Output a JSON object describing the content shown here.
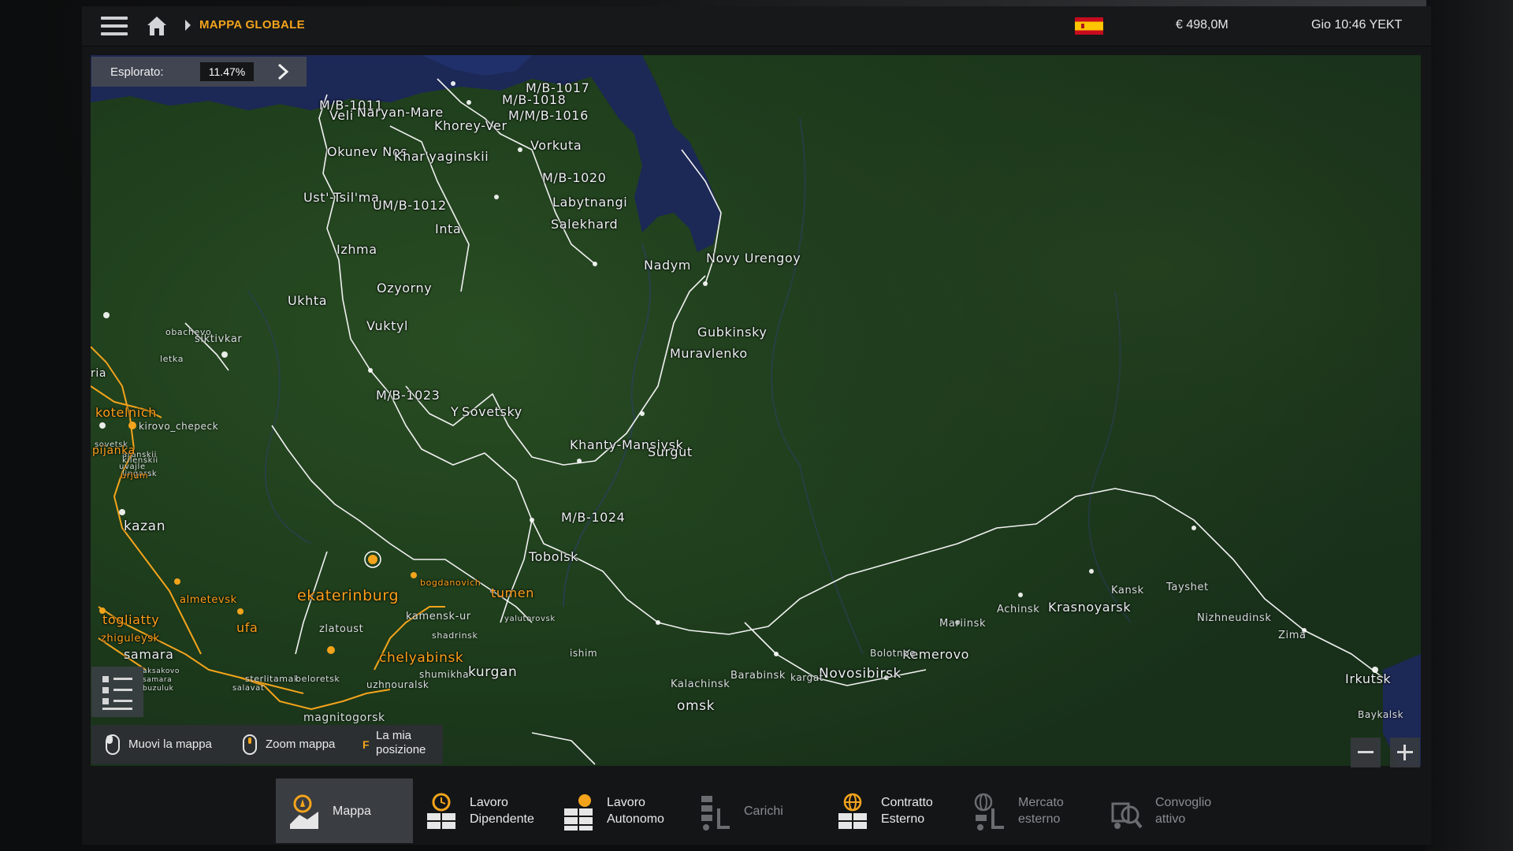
{
  "header": {
    "breadcrumb": "MAPPA GLOBALE",
    "money": "€ 498,0M",
    "clock": "Gio 10:46 YEKT"
  },
  "explored": {
    "label": "Esplorato:",
    "value": "11.47%"
  },
  "hints": {
    "move": "Muovi la mappa",
    "zoom": "Zoom mappa",
    "position_key": "F",
    "position_line1": "La mia",
    "position_line2": "posizione"
  },
  "colors": {
    "accent": "#f3a41c",
    "map_green": "#1d3a1b",
    "water": "#1c2a5c",
    "route_visited": "#f3a41c",
    "route_unvisited": "#ffffff"
  },
  "map": {
    "cities_white": [
      "M/B-1017",
      "M/B-1018",
      "M/M/B-1016",
      "M/B-1011",
      "Veli",
      "Naryan-Mare",
      "Khorey-Ver",
      "Vorkuta",
      "Okunev Nos",
      "Khar'yaginskii",
      "M/B-1020",
      "Ust'-Tsil'ma",
      "UM/B-1012",
      "Labytnangi",
      "Salekhard",
      "Inta",
      "Izhma",
      "Nadym",
      "Novy Urengoy",
      "Ozyorny",
      "Ukhta",
      "Vuktyl",
      "Gubkinsky",
      "Muravlenko",
      "M/B-1023",
      "Y",
      "Sovetsky",
      "Khanty-Mansiysk",
      "Surgut",
      "M/B-1024",
      "Tobolsk",
      "kurgan",
      "omsk",
      "Novosibirsk",
      "Kemerovo",
      "Krasnoyarsk",
      "Irkutsk"
    ],
    "cities_small": [
      "obachevo",
      "siktivkar",
      "letka",
      "ria",
      "kirovo_chepeck",
      "sovetsk",
      "aranskii",
      "kilenskii",
      "uvajle",
      "lingarsk",
      "kazan",
      "kamensk-ur",
      "zlatoust",
      "shadrinsk",
      "yalutorovsk",
      "ishim",
      "shumikha",
      "sterlitamak",
      "beloretsk",
      "salavat",
      "uzhnouralsk",
      "aksakovo",
      "samara",
      "buzuluk",
      "magnitogorsk",
      "Kalachinsk",
      "Barabinsk",
      "kargat",
      "Bolotnoe",
      "Mariinsk",
      "Achinsk",
      "Kansk",
      "Tayshet",
      "Nizhneudinsk",
      "Zima",
      "Baykalsk"
    ],
    "cities_orange": [
      "kotelnich",
      "pijanka",
      "urjum",
      "almetevsk",
      "togliatty",
      "zhiguleysk",
      "ufa",
      "ekaterinburg",
      "bogdanovich",
      "tumen",
      "chelyabinsk"
    ]
  },
  "nav": {
    "items": [
      {
        "line1": "Mappa",
        "line2": ""
      },
      {
        "line1": "Lavoro",
        "line2": "Dipendente"
      },
      {
        "line1": "Lavoro",
        "line2": "Autonomo"
      },
      {
        "line1": "Carichi",
        "line2": ""
      },
      {
        "line1": "Contratto",
        "line2": "Esterno"
      },
      {
        "line1": "Mercato",
        "line2": "esterno"
      },
      {
        "line1": "Convoglio",
        "line2": "attivo"
      }
    ]
  },
  "icons": {
    "menu": "hamburger-icon",
    "home": "home-icon",
    "flag": "spain-flag-icon",
    "legend": "legend-list-icon",
    "mouse": "mouse-icon",
    "zoom_in": "plus-icon",
    "zoom_out": "minus-icon"
  }
}
